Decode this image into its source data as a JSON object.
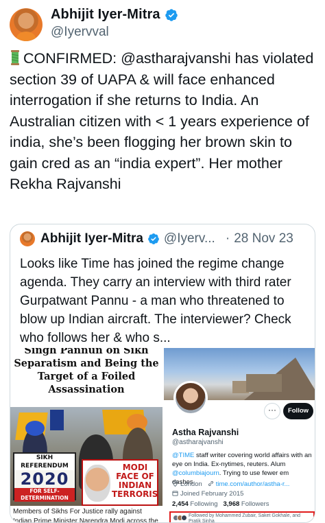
{
  "tweet": {
    "author": {
      "name": "Abhijit Iyer-Mitra",
      "handle": "@Iyervval",
      "verified": true
    },
    "emoji": "thread-icon",
    "text": "CONFIRMED: @astharajvanshi has violated section 39 of UAPA & will face enhanced interrogation if she returns to India. An Australian citizen with < 1 years experience of india, she’s been flogging her brown skin to gain cred as an “india expert”. Her mother Rekha Rajvanshi"
  },
  "quote": {
    "author": {
      "name": "Abhijit Iyer-Mitra",
      "handle": "@Iyerv...",
      "verified": true
    },
    "dot": "·",
    "date": "28 Nov 23",
    "text": "Looks like Time has joined the regime change agenda. They carry an interview with third rater Gurpatwant Pannu - a man who threatened to blow up Indian aircraft. The interviewer? Check who follows her & who s...",
    "media_left": {
      "headline": "Singh Pannun on Sikh Separatism and Being the Target of a Foiled Assassination",
      "sign1_top": "SIKH REFERENDUM",
      "sign1_year": "2020",
      "sign1_bottom": "FOR SELF-DETERMINATION",
      "sign2_text": "MODI FACE OF INDIAN TERRORISM",
      "sign2_banner": "",
      "caption": "Members of Sikhs For Justice rally against Indian Prime Minister Narendra Modi across the street from the White"
    },
    "media_right": {
      "more_label": "···",
      "follow_label": "Follow",
      "name": "Astha Rajvanshi",
      "handle": "@astharajvanshi",
      "bio_link1": "@TIME",
      "bio_mid": " staff writer covering world affairs with an eye on India. Ex-nytimes, reuters. Alum ",
      "bio_link2": "@columbiajourn",
      "bio_end": ". Trying to use fewer em dashes.",
      "location": "London",
      "website": "time.com/author/astha-r...",
      "joined": "Joined February 2015",
      "following_count": "2,454",
      "following_label": "Following",
      "followers_count": "3,968",
      "followers_label": "Followers",
      "followed_by": "Followed by Mohammed Zubair, Saket Gokhale, and Pratik Sinha"
    }
  },
  "colors": {
    "verified": "#1d9bf0",
    "link": "#1d9bf0",
    "highlight_box": "#e01b1b"
  }
}
